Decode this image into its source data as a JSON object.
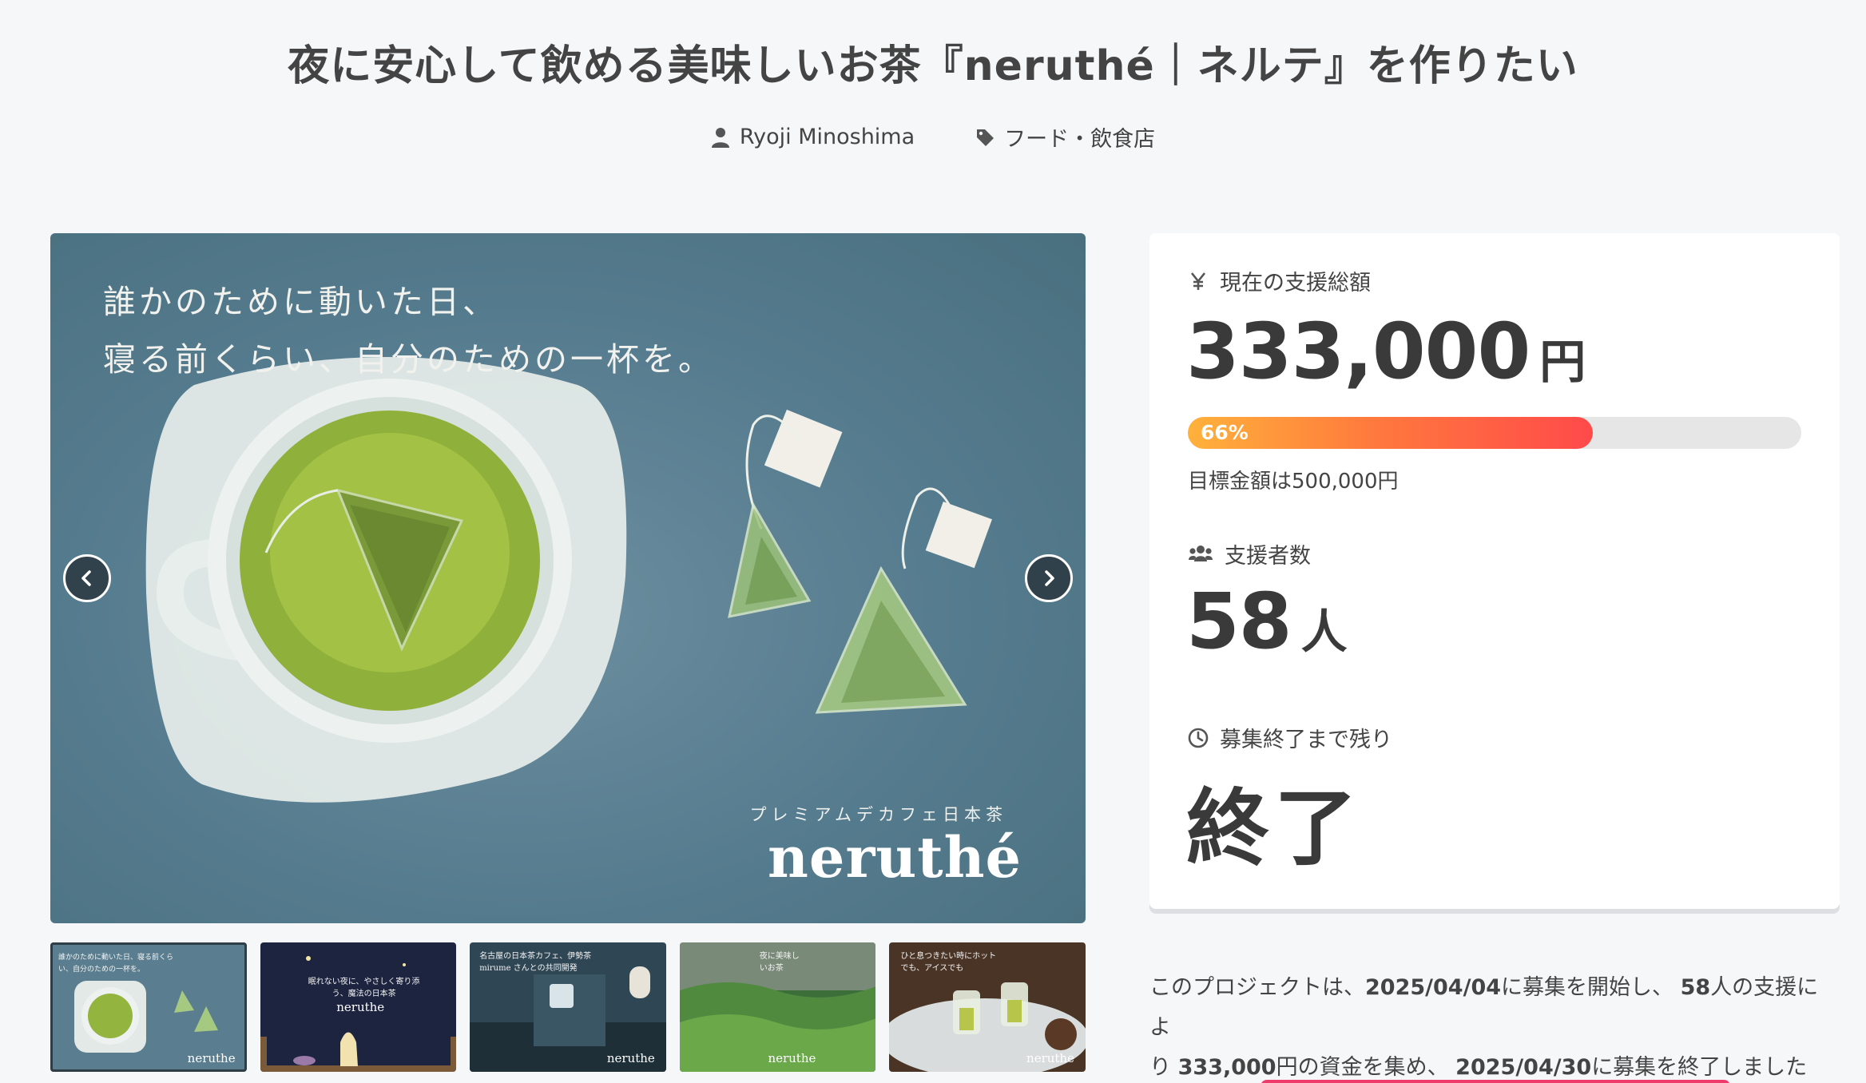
{
  "project": {
    "title": "夜に安心して飲める美味しいお茶『neruthé｜ネルテ』を作りたい",
    "author": "Ryoji Minoshima",
    "category": "フード・飲食店"
  },
  "hero": {
    "copy_line1": "誰かのために動いた日、",
    "copy_line2": "寝る前くらい、自分のための一杯を。",
    "brand_sub": "プレミアムデカフェ日本茶",
    "brand": "neruthé"
  },
  "thumbnails": [
    {
      "text": "誰かのために動いた日、寝る前くらい、自分のための一杯を。",
      "brand": "neruthe"
    },
    {
      "text": "眠れない夜に、やさしく寄り添う、魔法の日本茶",
      "brand": "neruthe"
    },
    {
      "text": "名古屋の日本茶カフェ、伊勢茶 mirume さんとの共同開発",
      "brand": "neruthe"
    },
    {
      "text": "夜に美味しいお茶",
      "brand": "neruthe"
    },
    {
      "text": "ひと息つきたい時にホットでも、アイスでも",
      "brand": "neruthe"
    }
  ],
  "stats": {
    "amount_label": "現在の支援総額",
    "amount_value": "333,000",
    "amount_unit": "円",
    "progress_percent": 66,
    "progress_label": "66%",
    "goal_text": "目標金額は500,000円",
    "backers_label": "支援者数",
    "backers_value": "58",
    "backers_unit": "人",
    "remaining_label": "募集終了まで残り",
    "remaining_value": "終了"
  },
  "summary": {
    "t1": "このプロジェクトは、",
    "start_date": "2025/04/04",
    "t2": "に募集を開始し、",
    "backers": "58",
    "t3": "人の支援によ",
    "t3b": "り",
    "amount": "333,000",
    "t4": "円の資金を集め、",
    "end_date": "2025/04/30",
    "t5": "に募集を終了しました"
  },
  "colors": {
    "accent": "#ff4a4a",
    "accent_start": "#ffb13b",
    "pink": "#ef3a6c",
    "hero_bg": "#557b8e"
  }
}
